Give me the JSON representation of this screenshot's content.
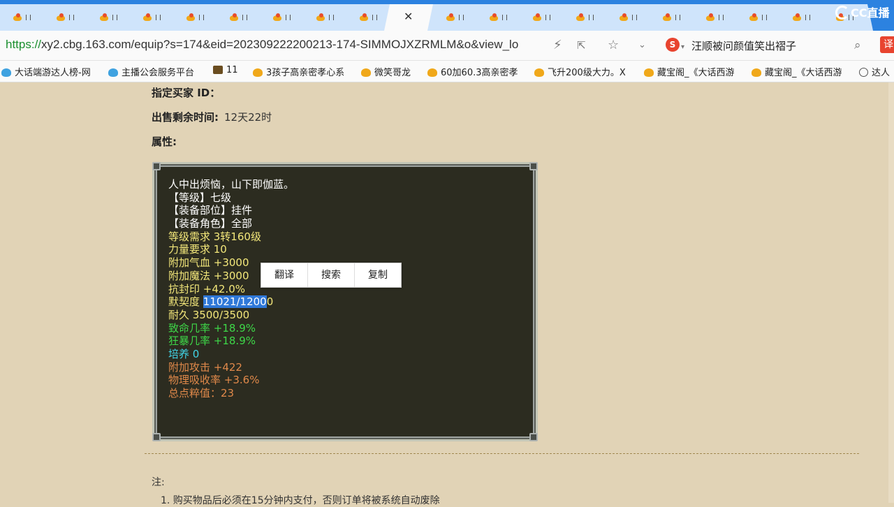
{
  "tabs": {
    "count": 20,
    "active_index": 9,
    "favicon": "game-character-icon"
  },
  "brand": {
    "logo_text": "CC直播"
  },
  "address_bar": {
    "url_scheme": "https://",
    "url_rest": "xy2.cbg.163.com/equip?s=174&eid=202309222200213-174-SIMMOJXZRMLM&o&view_lo",
    "hot_search": "汪顺被问颜值笑出褶子",
    "translate_label": "译"
  },
  "bookmarks": [
    {
      "label": "大话端游达人榜-网",
      "icon": "blue"
    },
    {
      "label": "主播公会服务平台",
      "icon": "blue"
    },
    {
      "label": "11",
      "icon": "dark"
    },
    {
      "label": "3孩子高亲密孝心系",
      "icon": "orange"
    },
    {
      "label": "微笑哥龙",
      "icon": "orange"
    },
    {
      "label": "60加60.3高亲密孝",
      "icon": "orange"
    },
    {
      "label": "飞升200级大力。X",
      "icon": "orange"
    },
    {
      "label": "藏宝阁_《大话西游",
      "icon": "orange"
    },
    {
      "label": "藏宝阁_《大话西游",
      "icon": "orange"
    },
    {
      "label": "达人",
      "icon": "globe"
    }
  ],
  "details": {
    "buyer_id_label": "指定买家 ID：",
    "remaining_label": "出售剩余时间:",
    "remaining_value": "12天22时",
    "attributes_label": "属性:"
  },
  "attributes": {
    "lines": [
      {
        "text": "人中出烦恼，山下即伽蓝。",
        "color": "#ffffff"
      },
      {
        "text": "【等级】七级",
        "color": "#ffffff"
      },
      {
        "text": "【装备部位】挂件",
        "color": "#ffffff"
      },
      {
        "text": "【装备角色】全部",
        "color": "#ffffff"
      },
      {
        "text": "等级需求 3转160级",
        "color": "#f3e77a"
      },
      {
        "text": "力量要求 10",
        "color": "#f3e77a"
      },
      {
        "text": "附加气血 +3000",
        "color": "#f3e77a"
      },
      {
        "text": "附加魔法 +3000",
        "color": "#f3e77a"
      },
      {
        "text": "抗封印 +42.0%",
        "color": "#f3e77a"
      },
      {
        "prefix": "默契度 ",
        "selected": "11021/1200",
        "suffix": "0",
        "color": "#f3e77a"
      },
      {
        "text": "耐久 3500/3500",
        "color": "#f3e77a"
      },
      {
        "text": "致命几率 +18.9%",
        "color": "#3ed748"
      },
      {
        "text": "狂暴几率 +18.9%",
        "color": "#3ed748"
      },
      {
        "text": "培养 0",
        "color": "#41d4e6"
      },
      {
        "text": "附加攻击 +422",
        "color": "#e0894a"
      },
      {
        "text": "物理吸收率 +3.6%",
        "color": "#e0894a"
      },
      {
        "text": "总点粹值：23",
        "color": "#e0894a"
      }
    ]
  },
  "context_menu": {
    "items": [
      "翻译",
      "搜索",
      "复制"
    ]
  },
  "notes": {
    "title": "注:",
    "items": [
      "1. 购买物品后必须在15分钟内支付，否则订单将被系统自动废除"
    ]
  }
}
